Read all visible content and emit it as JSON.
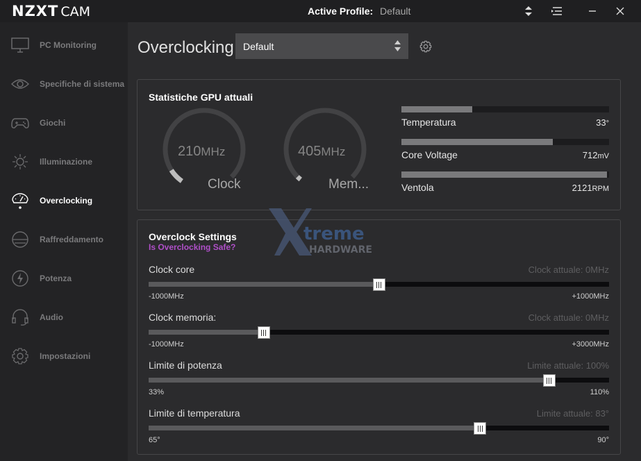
{
  "app": {
    "brand": "NZXT",
    "product": "CAM"
  },
  "titlebar": {
    "profile_label": "Active Profile:",
    "profile_value": "Default"
  },
  "sidebar": {
    "items": [
      {
        "label": "PC Monitoring",
        "icon": "monitor-icon"
      },
      {
        "label": "Specifiche di sistema",
        "icon": "eye-icon"
      },
      {
        "label": "Giochi",
        "icon": "gamepad-icon"
      },
      {
        "label": "Illuminazione",
        "icon": "sun-icon"
      },
      {
        "label": "Overclocking",
        "icon": "speedometer-icon",
        "active": true
      },
      {
        "label": "Raffreddamento",
        "icon": "cooling-icon"
      },
      {
        "label": "Potenza",
        "icon": "lightning-icon"
      },
      {
        "label": "Audio",
        "icon": "headset-icon"
      },
      {
        "label": "Impostazioni",
        "icon": "gear-icon"
      }
    ]
  },
  "main": {
    "title": "Overclocking",
    "profile_select": "Default"
  },
  "gpu_stats": {
    "title": "Statistiche GPU attuali",
    "clock": {
      "value": "210",
      "unit": "MHz",
      "label": "Clock"
    },
    "memory": {
      "value": "405",
      "unit": "MHz",
      "label": "Mem..."
    },
    "bars": [
      {
        "label": "Temperatura",
        "value": "33",
        "unit": "°",
        "fill": 0.34
      },
      {
        "label": "Core Voltage",
        "value": "712",
        "unit": "mV",
        "fill": 0.73
      },
      {
        "label": "Ventola",
        "value": "2121",
        "unit": "RPM",
        "fill": 0.99
      }
    ]
  },
  "overclock": {
    "title": "Overclock Settings",
    "link": "Is Overclocking Safe?",
    "settings": [
      {
        "label": "Clock core",
        "current": "Clock attuale: 0MHz",
        "min": "-1000MHz",
        "max": "+1000MHz",
        "position": 0.5
      },
      {
        "label": "Clock memoria:",
        "current": "Clock attuale: 0MHz",
        "min": "-1000MHz",
        "max": "+3000MHz",
        "position": 0.25
      },
      {
        "label": "Limite di potenza",
        "current": "Limite attuale: 100%",
        "min": "33%",
        "max": "110%",
        "position": 0.87
      },
      {
        "label": "Limite di temperatura",
        "current": "Limite attuale: 83°",
        "min": "65°",
        "max": "90°",
        "position": 0.72
      }
    ]
  },
  "watermark": {
    "line1": "treme",
    "line2": "HARDWARE"
  },
  "colors": {
    "accent_link": "#b04fc9",
    "panel_border": "#464648",
    "track": "#0c0c0e"
  }
}
